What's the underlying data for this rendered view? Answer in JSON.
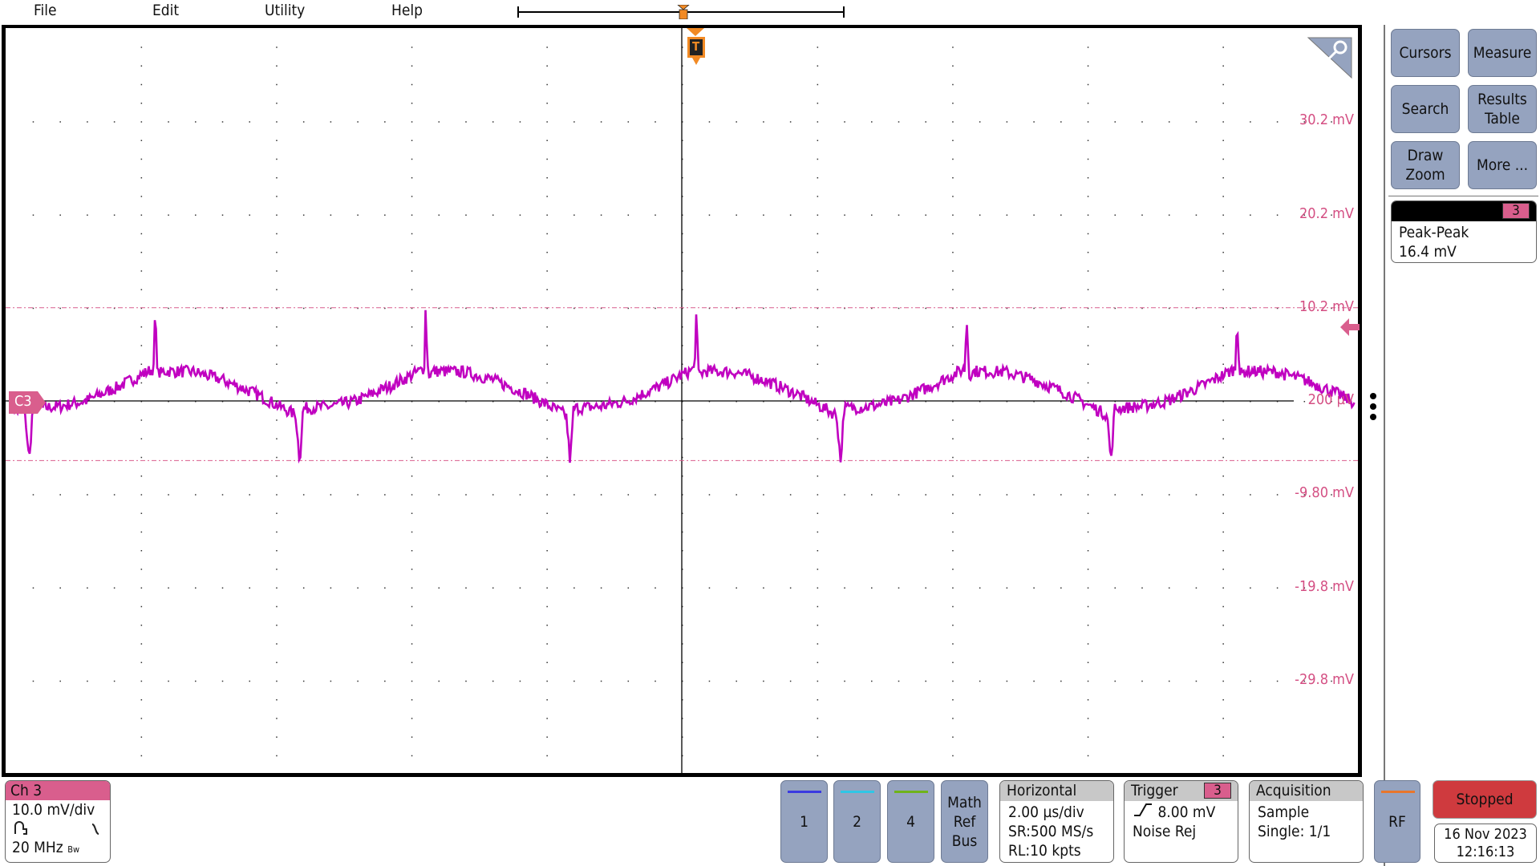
{
  "menu": {
    "file": "File",
    "edit": "Edit",
    "utility": "Utility",
    "help": "Help"
  },
  "colors": {
    "channel3": "#d95e8d",
    "trace": "#c000c0",
    "trigger": "#f28a24",
    "button": "#95a3bf",
    "stopped": "#cf3a3e",
    "ch1": "#3a3ae0",
    "ch2": "#2fc6e6",
    "ch4": "#6fb31a",
    "rf": "#e8762c"
  },
  "graticule": {
    "channel_marker": "C3",
    "vertical_labels": [
      "30.2 mV",
      "20.2 mV",
      "10.2 mV",
      "200 µV",
      "-9.80 mV",
      "-19.8 mV",
      "-29.8 mV"
    ],
    "trigger_marker": "T",
    "icons": [
      "zoom-magnifier-icon",
      "trigger-level-arrow-icon",
      "more-dots-icon"
    ]
  },
  "chart_data": {
    "type": "line",
    "xlabel": "",
    "ylabel": "",
    "x_unit": "µs",
    "y_unit": "mV",
    "xlim": [
      -10,
      10
    ],
    "ylim": [
      -39.8,
      40.2
    ],
    "x_per_div": 2.0,
    "y_per_div": 10.0,
    "offset_mV": 0.2,
    "grid": true,
    "period_us": 4.0,
    "positive_spikes_us": [
      -7.81,
      -3.81,
      0.19,
      4.19,
      8.19
    ],
    "period_shape": [
      [
        0,
        3.6
      ],
      [
        0.02,
        9.8
      ],
      [
        0.06,
        3.0
      ],
      [
        0.15,
        3.4
      ],
      [
        0.6,
        3.3
      ],
      [
        1.0,
        2.5
      ],
      [
        1.5,
        1.0
      ],
      [
        2.1,
        -1.3
      ],
      [
        2.16,
        -6.4
      ],
      [
        2.21,
        -0.6
      ],
      [
        2.6,
        -0.4
      ],
      [
        3.0,
        0.2
      ],
      [
        3.5,
        1.8
      ],
      [
        3.98,
        3.6
      ]
    ],
    "measurement_lines_mV": [
      10.2,
      -6.2
    ]
  },
  "sidebar": {
    "buttons": [
      {
        "label": "Cursors"
      },
      {
        "label": "Measure"
      },
      {
        "label": "Search"
      },
      {
        "label": "Results Table"
      },
      {
        "label": "Draw Zoom"
      },
      {
        "label": "More ..."
      }
    ],
    "measurement": {
      "source": "3",
      "name": "Peak-Peak",
      "value": "16.4 mV"
    }
  },
  "bottom": {
    "ch3": {
      "title": "Ch 3",
      "scale": "10.0 mV/div",
      "bandwidth": "20 MHz",
      "bw_suffix": "Bw"
    },
    "channels": [
      "1",
      "2",
      "4"
    ],
    "math": "Math\nRef\nBus",
    "horizontal": {
      "title": "Horizontal",
      "scale": "2.00 µs/div",
      "sr": "SR:500 MS/s",
      "rl": "RL:10 kpts"
    },
    "trigger": {
      "title": "Trigger",
      "source": "3",
      "level": "8.00 mV",
      "mode": "Noise Rej"
    },
    "acquisition": {
      "title": "Acquisition",
      "mode": "Sample",
      "count": "Single: 1/1"
    },
    "rf": "RF",
    "status": "Stopped",
    "date": "16 Nov 2023",
    "time": "12:16:13"
  }
}
